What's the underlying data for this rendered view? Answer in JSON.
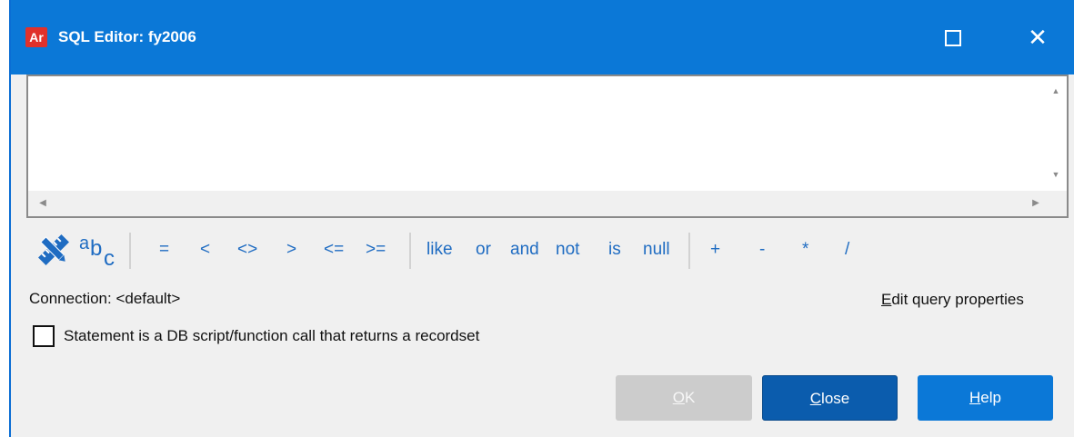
{
  "window": {
    "app_icon": "Ar",
    "title": "SQL Editor: fy2006",
    "maximize_icon": "maximize-icon",
    "close_icon": "close-icon",
    "close_glyph": "✕"
  },
  "editor": {
    "value": "",
    "placeholder": ""
  },
  "toolbar": {
    "operators": [
      "=",
      "<",
      "<>",
      ">",
      "<=",
      ">=",
      "like",
      "or",
      "and",
      "not",
      "is",
      "null",
      "+",
      "-",
      "*",
      "/"
    ],
    "abc_text": "abc"
  },
  "connection": {
    "text": "Connection: <default>"
  },
  "edit_query": {
    "first": "E",
    "rest": "dit query properties"
  },
  "checkbox": {
    "label": "Statement is a DB script/function call that returns a recordset",
    "checked": false
  },
  "buttons": {
    "ok": {
      "first": "O",
      "rest": "K"
    },
    "close": {
      "first": "C",
      "rest": "lose"
    },
    "help": {
      "first": "H",
      "rest": "elp"
    }
  },
  "colors": {
    "titlebar": "#0b78d7",
    "accent": "#1f6cc2",
    "ok_disabled": "#cccccc",
    "close_pressed": "#0b5cad"
  }
}
